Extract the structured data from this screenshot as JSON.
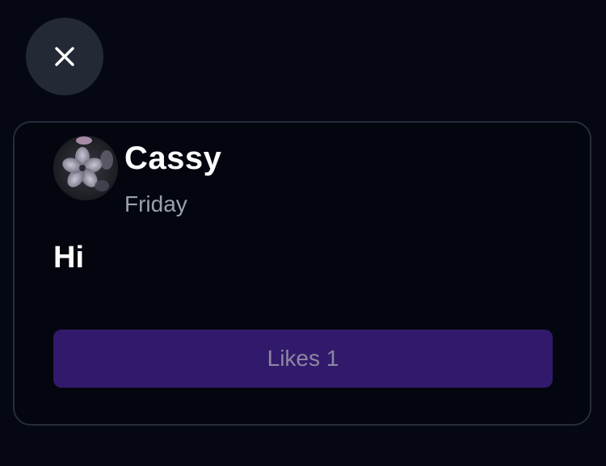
{
  "close": {
    "icon": "close-icon"
  },
  "post": {
    "author": "Cassy",
    "date": "Friday",
    "text": "Hi",
    "avatar": "flower-avatar",
    "likes_label": "Likes 1"
  },
  "colors": {
    "background": "#050814",
    "close_button": "#232a36",
    "card_border": "#272c38",
    "likes_button": "#311a6b",
    "likes_text": "#8d86a3",
    "date_text": "#9aa0ad"
  }
}
